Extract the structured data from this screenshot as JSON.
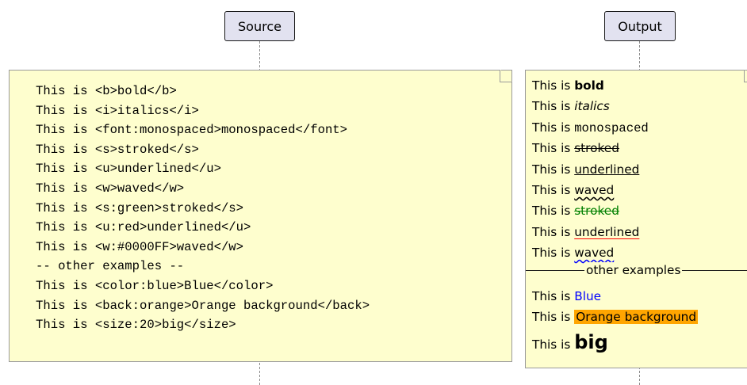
{
  "participants": {
    "source": "Source",
    "output": "Output"
  },
  "source_note": {
    "lines": [
      "This is <b>bold</b>",
      "This is <i>italics</i>",
      "This is <font:monospaced>monospaced</font>",
      "This is <s>stroked</s>",
      "This is <u>underlined</u>",
      "This is <w>waved</w>",
      "This is <s:green>stroked</s>",
      "This is <u:red>underlined</u>",
      "This is <w:#0000FF>waved</w>",
      "-- other examples --",
      "This is <color:blue>Blue</color>",
      "This is <back:orange>Orange background</back>",
      "This is <size:20>big</size>"
    ]
  },
  "output_note": {
    "prefix": "This is ",
    "bold": "bold",
    "italics": "italics",
    "monospaced": "monospaced",
    "stroked": "stroked",
    "underlined": "underlined",
    "waved": "waved",
    "stroked_green": "stroked",
    "underlined_red": "underlined",
    "waved_blue": "waved",
    "separator": "other examples",
    "blue": "Blue",
    "orange": "Orange background",
    "big": "big"
  },
  "colors": {
    "note_bg": "#fefece",
    "participant_bg": "#e2e2f0",
    "green": "#008000",
    "red": "#ff0000",
    "blue": "#0000ff",
    "orange": "#ffa500"
  }
}
